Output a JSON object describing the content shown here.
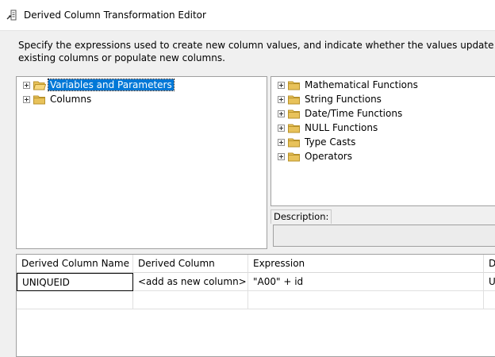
{
  "window": {
    "title": "Derived Column Transformation Editor",
    "icon": "transform-editor-icon"
  },
  "description_text": "Specify the expressions used to create new column values, and indicate whether the values update existing columns or populate new columns.",
  "left_tree": {
    "items": [
      {
        "label": "Variables and Parameters",
        "selected": true
      },
      {
        "label": "Columns",
        "selected": false
      }
    ]
  },
  "right_tree": {
    "items": [
      {
        "label": "Mathematical Functions"
      },
      {
        "label": "String Functions"
      },
      {
        "label": "Date/Time Functions"
      },
      {
        "label": "NULL Functions"
      },
      {
        "label": "Type Casts"
      },
      {
        "label": "Operators"
      }
    ]
  },
  "description_panel": {
    "label": "Description:",
    "value": ""
  },
  "grid": {
    "headers": [
      "Derived Column Name",
      "Derived Column",
      "Expression",
      "Da"
    ],
    "rows": [
      [
        "UNIQUEID",
        "<add as new column>",
        "\"A00\" + id",
        "Ur"
      ],
      [
        "",
        "",
        "",
        ""
      ]
    ]
  },
  "colors": {
    "selection": "#0078d7",
    "folder": "#e8c25a"
  }
}
